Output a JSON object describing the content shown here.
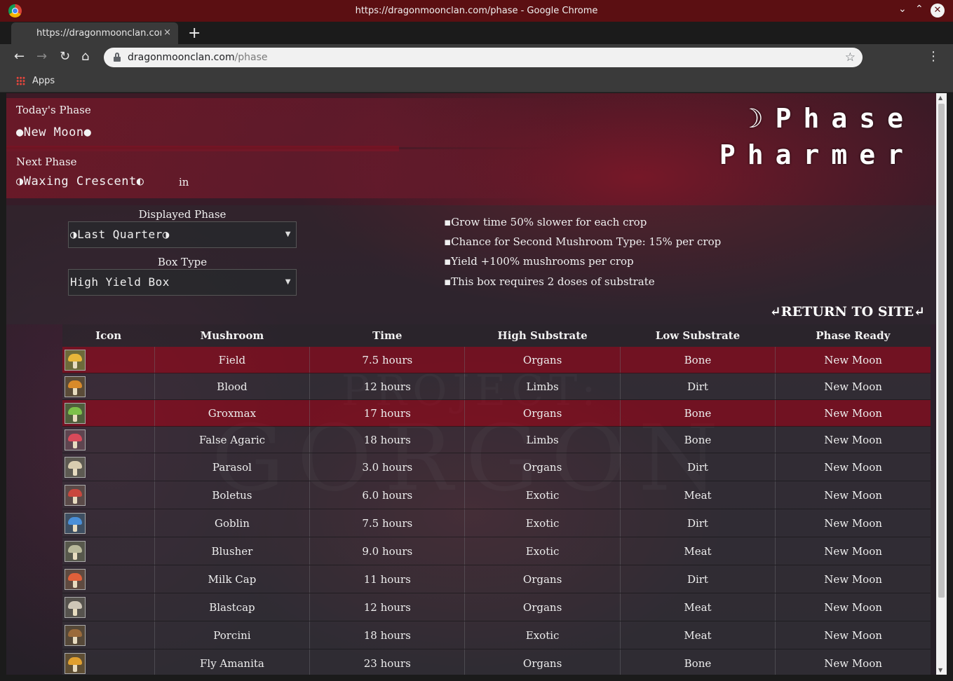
{
  "browser": {
    "window_title": "https://dragonmoonclan.com/phase - Google Chrome",
    "tab_title": "https://dragonmoonclan.com/phase",
    "tab_close": "×",
    "new_tab": "+",
    "url_host": "dragonmoonclan.com",
    "url_path": "/phase",
    "bookmark_apps": "Apps",
    "min_glyph": "⌄",
    "max_glyph": "⌃",
    "close_glyph": "✕"
  },
  "header": {
    "todays_phase_label": "Today's Phase",
    "todays_phase_value": "●New Moon●",
    "next_phase_label": "Next Phase",
    "next_phase_value": "◑Waxing Crescent◐",
    "in_label": "in",
    "logo_line1": "☽Phase",
    "logo_line2": "Pharmer"
  },
  "controls": {
    "displayed_phase_label": "Displayed Phase",
    "displayed_phase_value": "◑Last Quarter◑",
    "box_type_label": "Box Type",
    "box_type_value": "High Yield Box"
  },
  "info": [
    "▪Grow time 50% slower for each crop",
    "▪Chance for Second Mushroom Type: 15% per crop",
    "▪Yield +100% mushrooms per crop",
    "▪This box requires 2 doses of substrate"
  ],
  "return_link": "↵RETURN TO SITE↵",
  "watermark": {
    "line1": "PROJECT:",
    "line2": "GORGON"
  },
  "table": {
    "headers": [
      "Icon",
      "Mushroom",
      "Time",
      "High Substrate",
      "Low Substrate",
      "Phase Ready"
    ],
    "rows": [
      {
        "name": "Field",
        "time": "7.5 hours",
        "high": "Organs",
        "low": "Bone",
        "ready": "New Moon",
        "style": "red",
        "cap": "#e8b63a",
        "bg": "#6d6a3a"
      },
      {
        "name": "Blood",
        "time": "12 hours",
        "high": "Limbs",
        "low": "Dirt",
        "ready": "New Moon",
        "style": "grey",
        "cap": "#d88a2a",
        "bg": "#5a4b38"
      },
      {
        "name": "Groxmax",
        "time": "17 hours",
        "high": "Organs",
        "low": "Bone",
        "ready": "New Moon",
        "style": "red",
        "cap": "#7cc04a",
        "bg": "#4f5e3c"
      },
      {
        "name": "False Agaric",
        "time": "18 hours",
        "high": "Limbs",
        "low": "Bone",
        "ready": "New Moon",
        "style": "grey",
        "cap": "#d84a5a",
        "bg": "#5e4550"
      },
      {
        "name": "Parasol",
        "time": "3.0 hours",
        "high": "Organs",
        "low": "Dirt",
        "ready": "New Moon",
        "style": "grey",
        "cap": "#d9cdb0",
        "bg": "#5d5a52"
      },
      {
        "name": "Boletus",
        "time": "6.0 hours",
        "high": "Exotic",
        "low": "Meat",
        "ready": "New Moon",
        "style": "grey",
        "cap": "#c8473d",
        "bg": "#5a4a48"
      },
      {
        "name": "Goblin",
        "time": "7.5 hours",
        "high": "Exotic",
        "low": "Dirt",
        "ready": "New Moon",
        "style": "grey",
        "cap": "#4a8fd8",
        "bg": "#3e4f62"
      },
      {
        "name": "Blusher",
        "time": "9.0 hours",
        "high": "Exotic",
        "low": "Meat",
        "ready": "New Moon",
        "style": "grey",
        "cap": "#b8b89a",
        "bg": "#57584c"
      },
      {
        "name": "Milk Cap",
        "time": "11 hours",
        "high": "Organs",
        "low": "Dirt",
        "ready": "New Moon",
        "style": "grey",
        "cap": "#e0603a",
        "bg": "#5e4a40"
      },
      {
        "name": "Blastcap",
        "time": "12 hours",
        "high": "Organs",
        "low": "Meat",
        "ready": "New Moon",
        "style": "grey",
        "cap": "#cfc7b8",
        "bg": "#56534e"
      },
      {
        "name": "Porcini",
        "time": "18 hours",
        "high": "Exotic",
        "low": "Meat",
        "ready": "New Moon",
        "style": "grey",
        "cap": "#9a6a3a",
        "bg": "#554838"
      },
      {
        "name": "Fly Amanita",
        "time": "23 hours",
        "high": "Organs",
        "low": "Bone",
        "ready": "New Moon",
        "style": "grey",
        "cap": "#e0a030",
        "bg": "#5e4e34"
      }
    ]
  }
}
